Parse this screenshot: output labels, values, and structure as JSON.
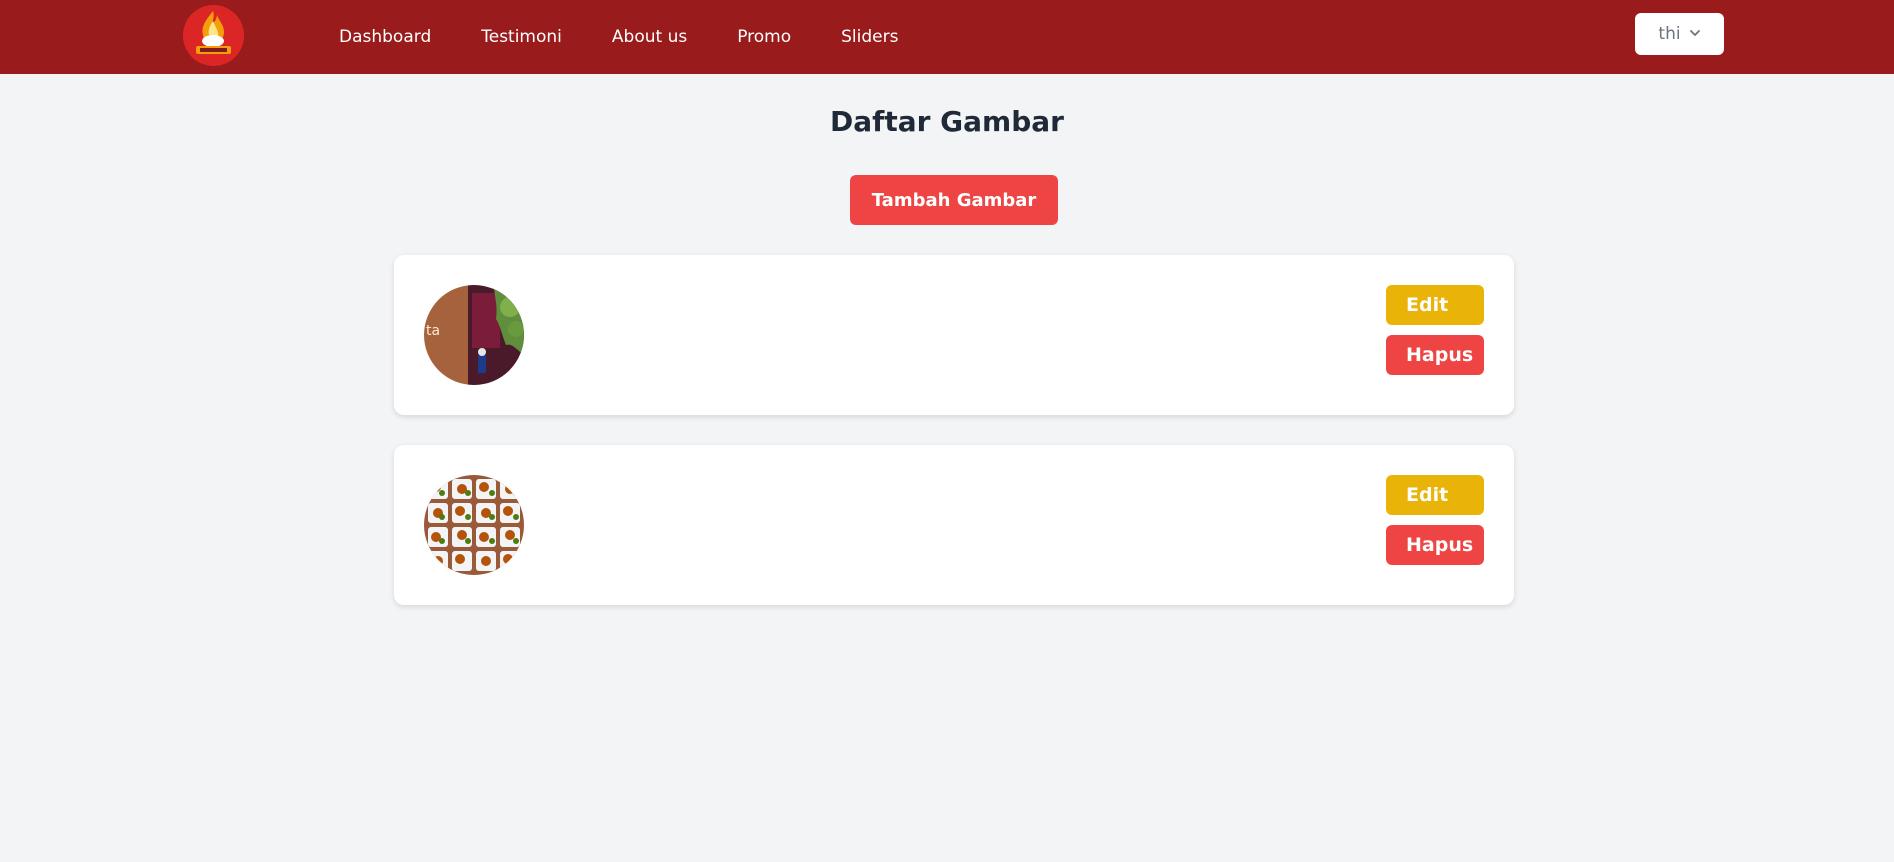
{
  "navbar": {
    "links": [
      {
        "label": "Dashboard"
      },
      {
        "label": "Testimoni"
      },
      {
        "label": "About us"
      },
      {
        "label": "Promo"
      },
      {
        "label": "Sliders"
      }
    ],
    "user_label": "thi",
    "bg_color": "#991b1b"
  },
  "page": {
    "title": "Daftar Gambar",
    "add_button_label": "Tambah Gambar"
  },
  "items": [
    {
      "thumb_text": "ta",
      "edit_label": "Edit",
      "delete_label": "Hapus"
    },
    {
      "edit_label": "Edit",
      "delete_label": "Hapus"
    }
  ],
  "colors": {
    "primary": "#ef4444",
    "edit": "#eab308",
    "background": "#f3f4f6"
  }
}
